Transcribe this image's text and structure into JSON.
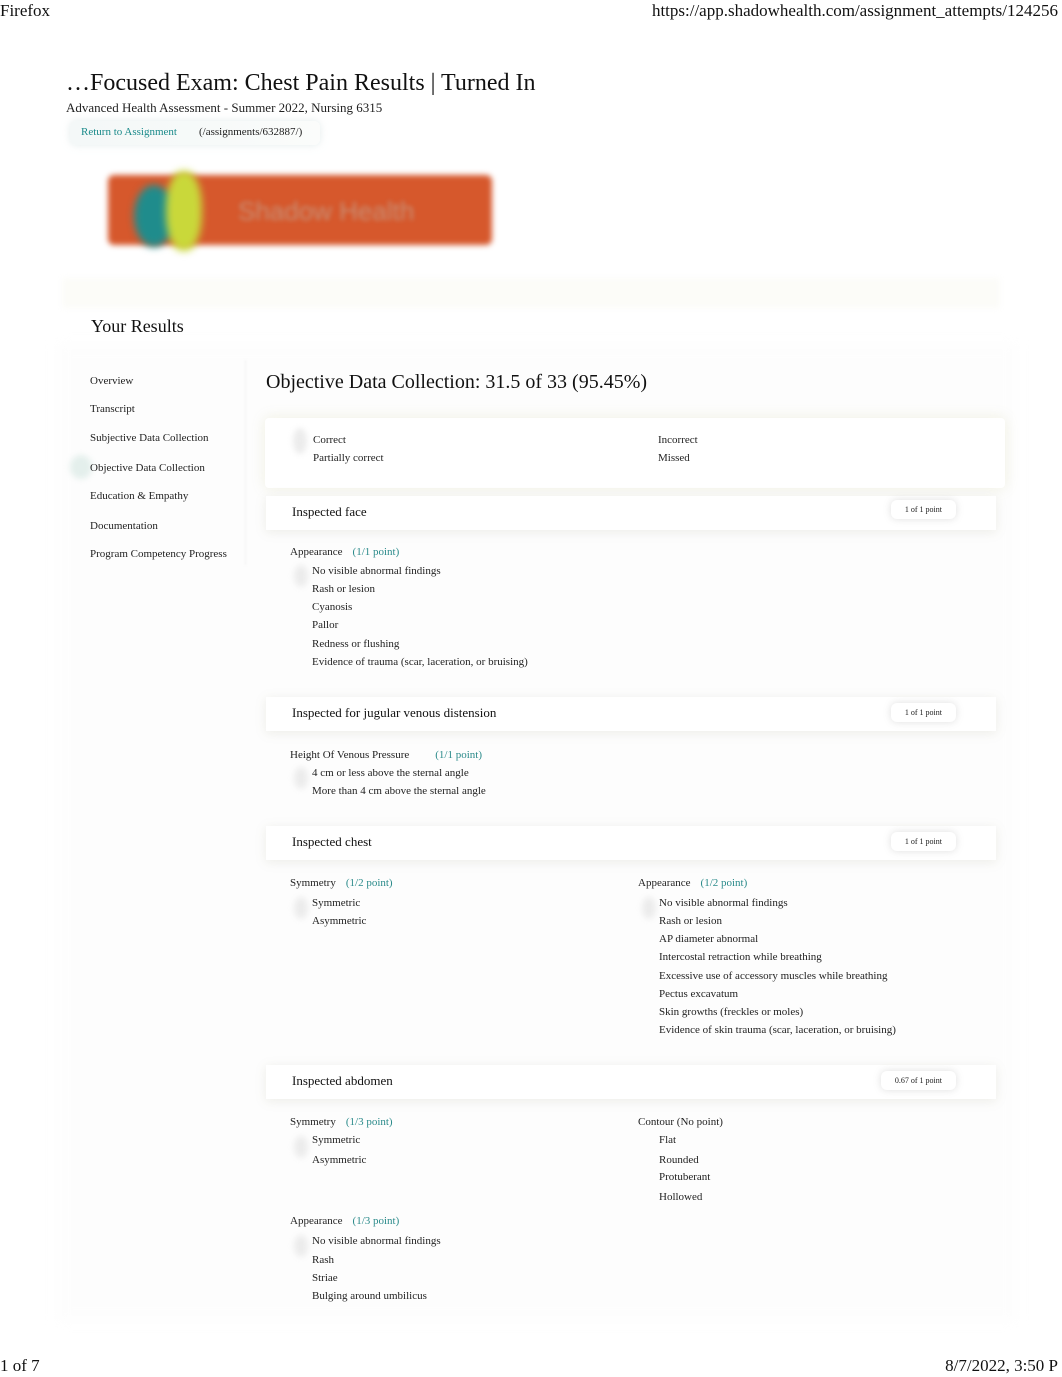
{
  "print_header": {
    "browser": "Firefox",
    "url": "https://app.shadowhealth.com/assignment_attempts/124256"
  },
  "print_footer": {
    "page": "1 of 7",
    "datetime": "8/7/2022, 3:50 P"
  },
  "page": {
    "title": "…Focused Exam: Chest Pain Results | Turned In",
    "course": "Advanced Health Assessment - Summer 2022, Nursing 6315",
    "return_link": "Return to Assignment",
    "return_path": "(/assignments/632887/)",
    "logo_text": "Shadow Health",
    "brand_color": "#d6582c",
    "accent_color": "#2a8a8a"
  },
  "results": {
    "heading": "Your Results"
  },
  "sidebar": {
    "items": [
      {
        "label": "Overview"
      },
      {
        "label": "Transcript"
      },
      {
        "label": "Subjective Data Collection"
      },
      {
        "label": "Objective Data Collection",
        "active": true
      },
      {
        "label": "Education & Empathy"
      },
      {
        "label": "Documentation"
      },
      {
        "label": "Program Competency Progress"
      }
    ]
  },
  "main": {
    "heading": "Objective Data Collection: 31.5 of 33 (95.45%)",
    "legend": {
      "correct": "Correct",
      "partially_correct": "Partially correct",
      "incorrect": "Incorrect",
      "missed": "Missed"
    },
    "sections": [
      {
        "title": "Inspected face",
        "score": "1 of 1 point",
        "groups": [
          {
            "label": "Appearance",
            "points": "(1/1 point)",
            "options": [
              "No visible abnormal findings",
              "Rash or lesion",
              "Cyanosis",
              "Pallor",
              "Redness or flushing",
              "Evidence of trauma (scar, laceration, or bruising)"
            ]
          }
        ]
      },
      {
        "title": "Inspected for jugular venous distension",
        "score": "1 of 1 point",
        "groups": [
          {
            "label": "Height Of Venous Pressure",
            "points": "(1/1 point)",
            "options": [
              "4 cm or less above the sternal angle",
              "More than 4 cm above the sternal angle"
            ]
          }
        ]
      },
      {
        "title": "Inspected chest",
        "score": "1 of 1 point",
        "groups": [
          {
            "label": "Symmetry",
            "points": "(1/2 point)",
            "options": [
              "Symmetric",
              "Asymmetric"
            ]
          },
          {
            "label": "Appearance",
            "points": "(1/2 point)",
            "options": [
              "No visible abnormal findings",
              "Rash or lesion",
              "AP diameter abnormal",
              "Intercostal retraction while breathing",
              "Excessive use of accessory muscles while breathing",
              "Pectus excavatum",
              "Skin growths (freckles or moles)",
              "Evidence of skin trauma (scar, laceration, or bruising)"
            ]
          }
        ]
      },
      {
        "title": "Inspected abdomen",
        "score": "0.67 of 1 point",
        "groups": [
          {
            "label": "Symmetry",
            "points": "(1/3 point)",
            "options": [
              "Symmetric",
              "Asymmetric"
            ]
          },
          {
            "label": "Contour (No point)",
            "points": "",
            "options": [
              "Flat",
              "Rounded",
              "Protuberant",
              "Hollowed"
            ]
          },
          {
            "label": "Appearance",
            "points": "(1/3 point)",
            "options": [
              "No visible abnormal findings",
              "Rash",
              "Striae",
              "Bulging around umbilicus"
            ]
          }
        ]
      }
    ]
  }
}
